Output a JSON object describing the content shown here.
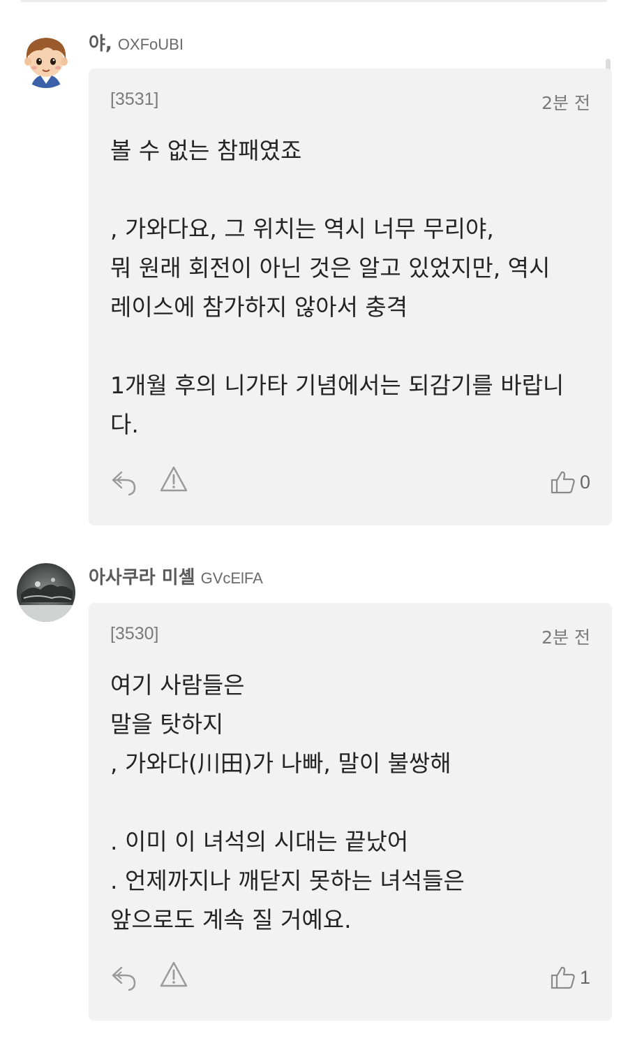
{
  "comments": [
    {
      "nickname": "야,",
      "user_id": "OXFoUBI",
      "post_id": "[3531]",
      "time": "2분 전",
      "body": "볼 수 없는 참패였죠\n\n, 가와다요, 그 위치는 역시 너무 무리야,\n뭐 원래 회전이 아닌 것은 알고 있었지만, 역시\n레이스에 참가하지 않아서 충격\n\n1개월 후의 니가타 기념에서는 되감기를 바랍니\n다.",
      "likes": "0"
    },
    {
      "nickname": "아사쿠라 미셸",
      "user_id": "GVcElFA",
      "post_id": "[3530]",
      "time": "2분 전",
      "body": "여기 사람들은\n말을 탓하지\n, 가와다(川田)가 나빠, 말이 불쌍해\n\n. 이미 이 녀석의 시대는 끝났어\n. 언제까지나 깨닫지 못하는 녀석들은\n앞으로도 계속 질 거예요.",
      "likes": "1"
    }
  ],
  "icons": {
    "reply": "reply-icon",
    "report": "warning-triangle-icon",
    "like": "thumbs-up-icon"
  },
  "colors": {
    "card_background": "#f2f2f2",
    "nickname": "#595959",
    "meta_text": "#7a7a7a"
  }
}
